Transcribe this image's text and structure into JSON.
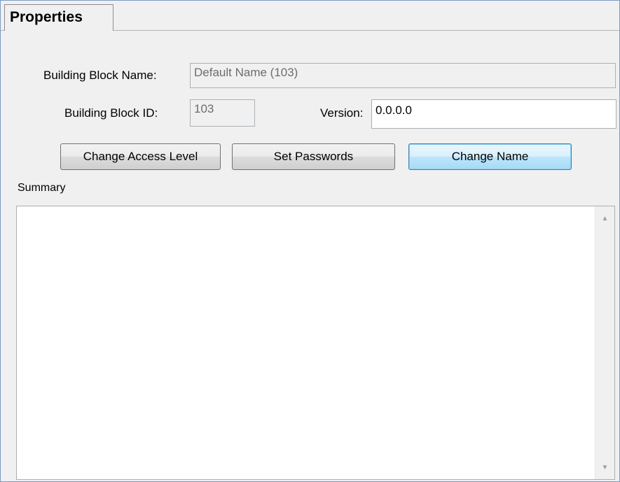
{
  "tabs": [
    {
      "label": "Properties",
      "active": true
    }
  ],
  "form": {
    "name_label": "Building Block Name:",
    "name_value": "Default Name (103)",
    "id_label": "Building Block ID:",
    "id_value": "103",
    "version_label": "Version:",
    "version_value": "0.0.0.0"
  },
  "buttons": {
    "change_access_level": "Change Access Level",
    "set_passwords": "Set Passwords",
    "change_name": "Change Name"
  },
  "summary": {
    "label": "Summary",
    "value": ""
  },
  "icons": {
    "scroll_up": "scroll-up-arrow-icon",
    "scroll_down": "scroll-down-arrow-icon"
  },
  "colors": {
    "window_border": "#7a9cc4",
    "default_button_fill": "#bee6fd",
    "panel_background": "#f0f0f0"
  }
}
